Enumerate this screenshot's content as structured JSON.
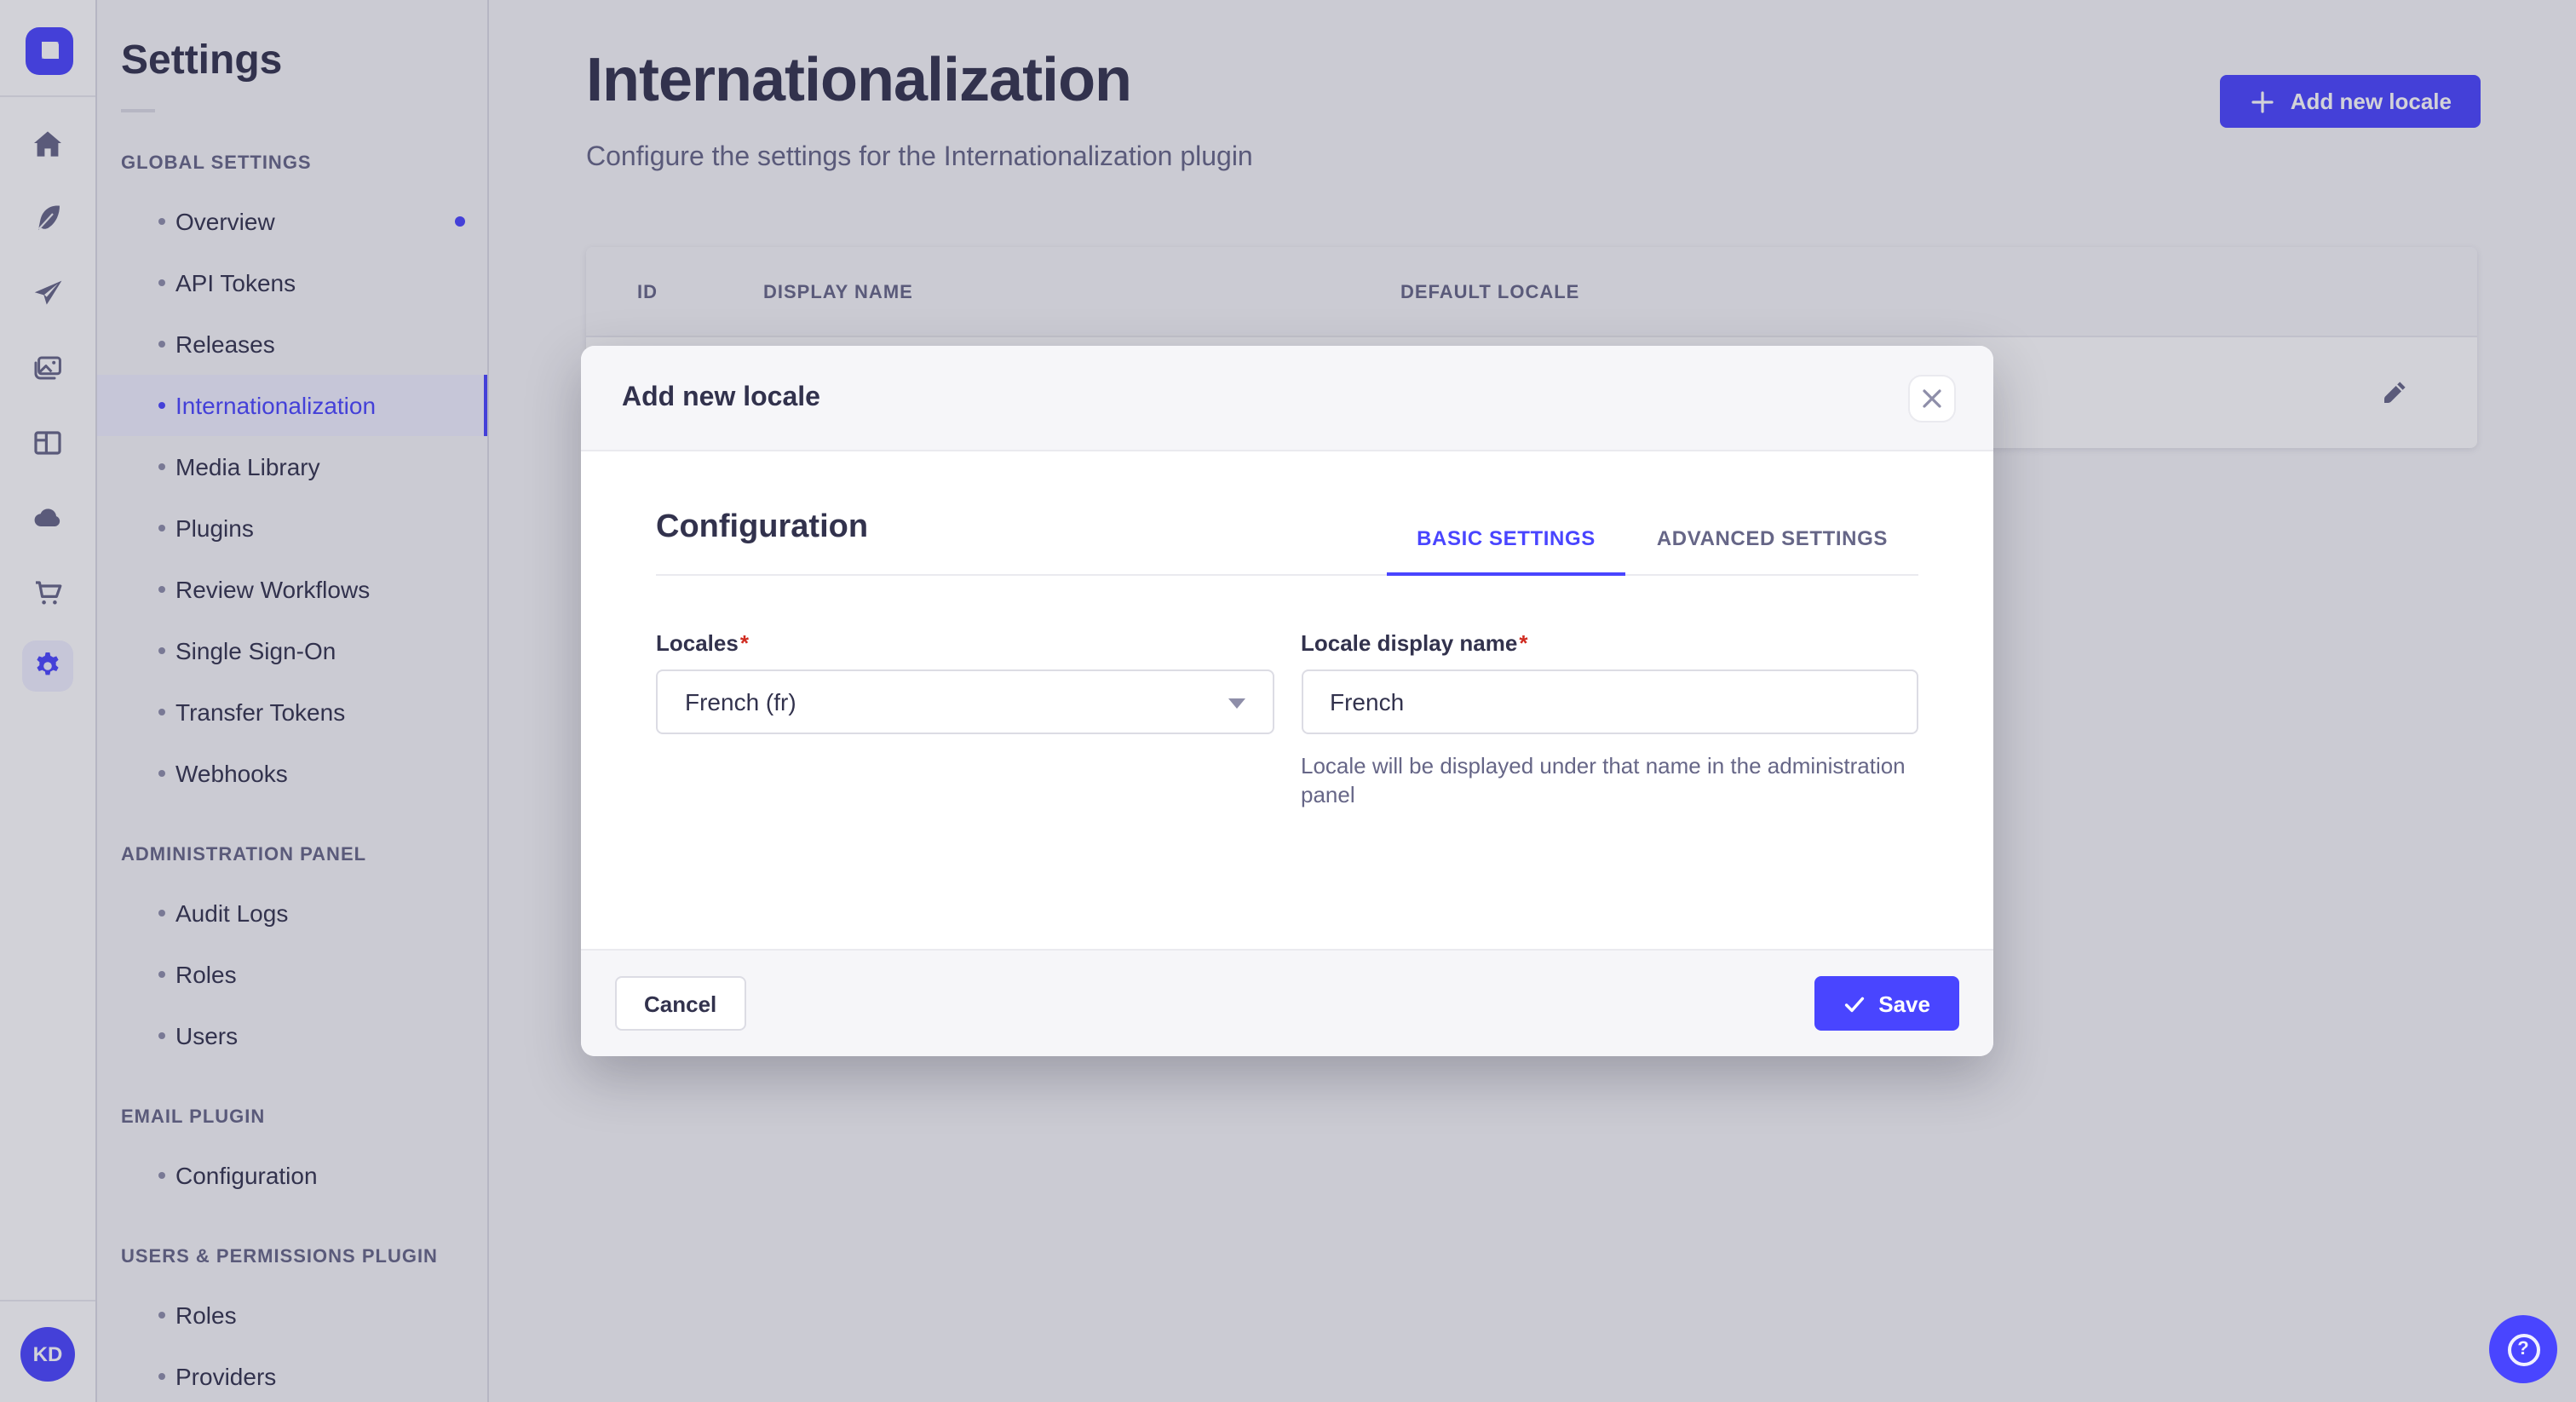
{
  "brand": {
    "logo": "strapi-logo",
    "avatar_initials": "KD"
  },
  "rail": {
    "icons": [
      "home",
      "feather-content",
      "paper-plane",
      "media-library",
      "layout-builder",
      "cloud",
      "marketplace-cart",
      "settings-gear"
    ]
  },
  "sidebar": {
    "title": "Settings",
    "sections": [
      {
        "label": "GLOBAL SETTINGS",
        "items": [
          {
            "label": "Overview",
            "has_dot": true
          },
          {
            "label": "API Tokens"
          },
          {
            "label": "Releases"
          },
          {
            "label": "Internationalization",
            "active": true
          },
          {
            "label": "Media Library"
          },
          {
            "label": "Plugins"
          },
          {
            "label": "Review Workflows"
          },
          {
            "label": "Single Sign-On"
          },
          {
            "label": "Transfer Tokens"
          },
          {
            "label": "Webhooks"
          }
        ]
      },
      {
        "label": "ADMINISTRATION PANEL",
        "items": [
          {
            "label": "Audit Logs"
          },
          {
            "label": "Roles"
          },
          {
            "label": "Users"
          }
        ]
      },
      {
        "label": "EMAIL PLUGIN",
        "items": [
          {
            "label": "Configuration"
          }
        ]
      },
      {
        "label": "USERS & PERMISSIONS PLUGIN",
        "items": [
          {
            "label": "Roles"
          },
          {
            "label": "Providers"
          }
        ]
      }
    ]
  },
  "main": {
    "title": "Internationalization",
    "subtitle": "Configure the settings for the Internationalization plugin",
    "add_button_label": "Add new locale"
  },
  "table": {
    "columns": [
      "ID",
      "DISPLAY NAME",
      "DEFAULT LOCALE"
    ],
    "row_action_icon": "pencil-edit"
  },
  "modal": {
    "title": "Add new locale",
    "section_title": "Configuration",
    "tabs": [
      {
        "label": "BASIC SETTINGS",
        "active": true
      },
      {
        "label": "ADVANCED SETTINGS",
        "active": false
      }
    ],
    "fields": {
      "locales": {
        "label": "Locales",
        "required_mark": "*",
        "value": "French (fr)"
      },
      "display_name": {
        "label": "Locale display name",
        "required_mark": "*",
        "value": "French",
        "help": "Locale will be displayed under that name in the administration panel"
      }
    },
    "cancel_label": "Cancel",
    "save_label": "Save"
  },
  "colors": {
    "primary": "#4945ff",
    "primary_light": "#f0f0ff",
    "text_dark": "#32324d",
    "text_muted": "#666687",
    "page_bg": "#f6f6f9",
    "border": "#dcdce4",
    "required_red": "#d02b20",
    "overlay": "rgba(50,50,77,0.22)"
  }
}
